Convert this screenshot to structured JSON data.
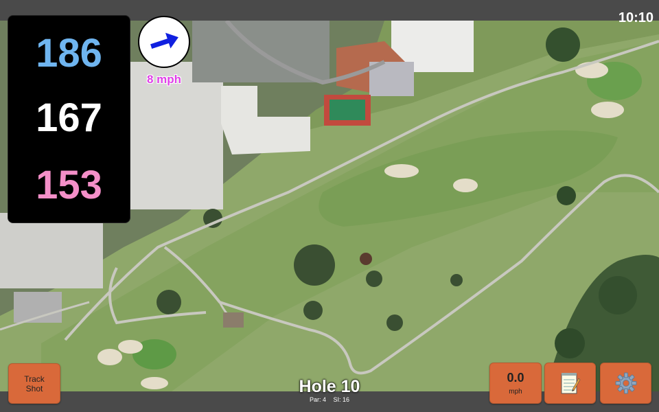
{
  "status": {
    "time": "10:10"
  },
  "distances": {
    "back": "186",
    "middle": "167",
    "front": "153"
  },
  "wind": {
    "speed": "8 mph",
    "direction_icon": "wind-arrow-icon"
  },
  "hole": {
    "title": "Hole 10",
    "par": "Par: 4",
    "si": "SI: 16"
  },
  "buttons": {
    "track_line1": "Track",
    "track_line2": "Shot",
    "speed_value": "0.0",
    "speed_unit": "mph",
    "notes_icon": "notepad-icon",
    "settings_icon": "gear-icon"
  },
  "colors": {
    "back_distance": "#6fb5f0",
    "middle_distance": "#ffffff",
    "front_distance": "#f48fc8",
    "wind_text": "#e040e8",
    "wind_arrow": "#1020e0",
    "button": "#d9693a"
  }
}
